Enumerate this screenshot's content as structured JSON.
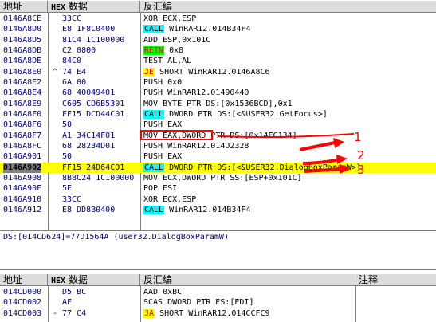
{
  "top_panel": {
    "headers": {
      "address": "地址",
      "hex_prefix": "HEX",
      "hex_suffix": "数据",
      "disasm": "反汇编"
    },
    "rows": [
      {
        "addr": "0146A8CE",
        "mark": "",
        "hex": "33CC",
        "dis": "XOR ECX,ESP"
      },
      {
        "addr": "0146A8D0",
        "mark": "",
        "hex": "E8 1F8C0400",
        "tag": "CALL",
        "tagtype": "call",
        "dis": " WinRAR12.014B34F4"
      },
      {
        "addr": "0146A8D5",
        "mark": "",
        "hex": "81C4 1C100000",
        "dis": "ADD ESP,0x101C"
      },
      {
        "addr": "0146A8DB",
        "mark": "",
        "hex": "C2 0800",
        "tag": "RETN",
        "tagtype": "ret",
        "dis": " 0x8"
      },
      {
        "addr": "0146A8DE",
        "mark": "",
        "hex": "84C0",
        "dis": "TEST AL,AL"
      },
      {
        "addr": "0146A8E0",
        "mark": "^",
        "hex": "74 E4",
        "tag": "JE",
        "tagtype": "jmp",
        "dis": " SHORT WinRAR12.0146A8C6"
      },
      {
        "addr": "0146A8E2",
        "mark": "",
        "hex": "6A 00",
        "dis": "PUSH 0x0"
      },
      {
        "addr": "0146A8E4",
        "mark": "",
        "hex": "68 40049401",
        "dis": "PUSH WinRAR12.01490440"
      },
      {
        "addr": "0146A8E9",
        "mark": "",
        "hex": "C605 CD6B5301",
        "dis": "MOV BYTE PTR DS:[0x1536BCD],0x1"
      },
      {
        "addr": "0146A8F0",
        "mark": "",
        "hex": "FF15 DCD44C01",
        "tag": "CALL",
        "tagtype": "call",
        "dis": " DWORD PTR DS:[<&USER32.GetFocus>]"
      },
      {
        "addr": "0146A8F6",
        "mark": "",
        "hex": "50",
        "dis": "PUSH EAX"
      },
      {
        "addr": "0146A8F7",
        "mark": "",
        "hex": "A1 34C14F01",
        "dis": "MOV EAX,DWORD PTR DS:[0x14FC134]"
      },
      {
        "addr": "0146A8FC",
        "mark": "",
        "hex": "68 28234D01",
        "dis": "PUSH WinRAR12.014D2328"
      },
      {
        "addr": "0146A901",
        "mark": "",
        "hex": "50",
        "dis": "PUSH EAX"
      },
      {
        "addr": "0146A902",
        "mark": "",
        "hex": "FF15 24D64C01",
        "tag": "CALL",
        "tagtype": "call",
        "dis": " DWORD PTR DS:[<&USER32.DialogBoxParamW>]",
        "selected": true
      },
      {
        "addr": "0146A908",
        "mark": "",
        "hex": "8B8C24 1C100000",
        "dis": "MOV ECX,DWORD PTR SS:[ESP+0x101C]"
      },
      {
        "addr": "0146A90F",
        "mark": "",
        "hex": "5E",
        "dis": "POP ESI"
      },
      {
        "addr": "0146A910",
        "mark": "",
        "hex": "33CC",
        "dis": "XOR ECX,ESP"
      },
      {
        "addr": "0146A912",
        "mark": "",
        "hex": "E8 DD8B0400",
        "tag": "CALL",
        "tagtype": "call",
        "dis": " WinRAR12.014B34F4"
      }
    ]
  },
  "info_line": "DS:[014CD624]=77D1564A (user32.DialogBoxParamW)",
  "annotations": [
    "1",
    "2",
    "3"
  ],
  "bottom_panel": {
    "headers": {
      "address": "地址",
      "hex_prefix": "HEX",
      "hex_suffix": "数据",
      "disasm": "反汇编",
      "comment": "注释"
    },
    "rows": [
      {
        "addr": "014CD000",
        "mark": "",
        "hex": "D5 BC",
        "dis": "AAD 0xBC"
      },
      {
        "addr": "014CD002",
        "mark": "",
        "hex": "AF",
        "dis": "SCAS DWORD PTR ES:[EDI]"
      },
      {
        "addr": "014CD003",
        "mark": "-",
        "hex": "77 C4",
        "tag": "JA",
        "tagtype": "jmp",
        "dis": " SHORT WinRAR12.014CCFC9"
      }
    ]
  },
  "colors": {
    "accent_red": "#ff0000",
    "selection": "#ffff00",
    "call_bg": "#00ffff"
  }
}
